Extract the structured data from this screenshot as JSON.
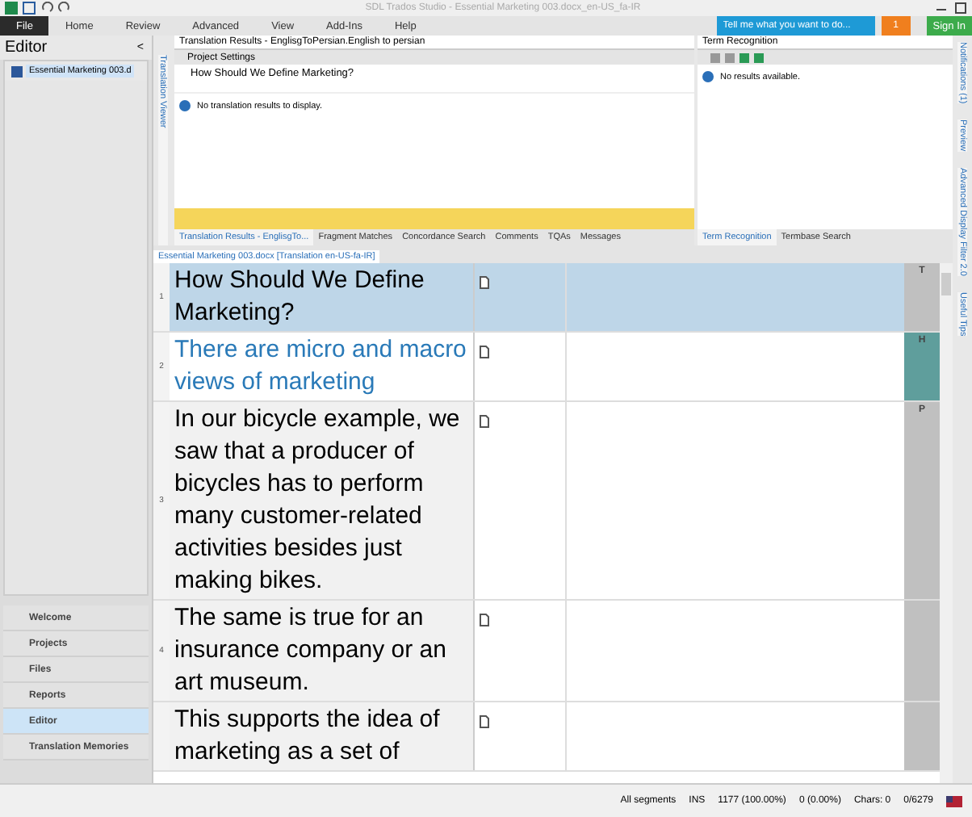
{
  "window": {
    "title": "SDL Trados Studio - Essential Marketing 003.docx_en-US_fa-IR"
  },
  "ribbon_tabs": [
    {
      "label": "File",
      "selected": true
    },
    {
      "label": "Home",
      "selected": false
    },
    {
      "label": "Review",
      "selected": false
    },
    {
      "label": "Advanced",
      "selected": false
    },
    {
      "label": "View",
      "selected": false
    },
    {
      "label": "Add-Ins",
      "selected": false
    },
    {
      "label": "Help",
      "selected": false
    }
  ],
  "tell_me": {
    "placeholder": "Tell me what you want to do..."
  },
  "notification_count": "1",
  "sign_in": "Sign In",
  "sidebar": {
    "title": "Editor",
    "collapse": "<",
    "file": "Essential Marketing 003.d",
    "nav": [
      {
        "label": "Welcome",
        "selected": false
      },
      {
        "label": "Projects",
        "selected": false
      },
      {
        "label": "Files",
        "selected": false
      },
      {
        "label": "Reports",
        "selected": false
      },
      {
        "label": "Editor",
        "selected": true
      },
      {
        "label": "Translation Memories",
        "selected": false
      }
    ]
  },
  "translation_viewer": "Translation Viewer",
  "translation_results": {
    "title": "Translation Results - EnglisgToPersian.English to persian",
    "settings": "Project Settings",
    "source": "How Should We Define Marketing?",
    "message": "No translation results to display.",
    "tabs": [
      {
        "label": "Translation Results - EnglisgTo...",
        "selected": true
      },
      {
        "label": "Fragment Matches",
        "selected": false
      },
      {
        "label": "Concordance Search",
        "selected": false
      },
      {
        "label": "Comments",
        "selected": false
      },
      {
        "label": "TQAs",
        "selected": false
      },
      {
        "label": "Messages",
        "selected": false
      }
    ]
  },
  "term_recognition": {
    "title": "Term Recognition",
    "message": "No results available.",
    "tabs": [
      {
        "label": "Term Recognition",
        "selected": true
      },
      {
        "label": "Termbase Search",
        "selected": false
      }
    ]
  },
  "side_tabs": [
    "Notifications (1)",
    "Preview",
    "Advanced Display Filter 2.0",
    "Useful Tips"
  ],
  "editor": {
    "tab": "Essential Marketing 003.docx [Translation en-US-fa-IR]",
    "rows": [
      {
        "number": "1",
        "source": "How Should We Define Marketing?",
        "selected": true,
        "highlighted": false,
        "status": "T",
        "color": "#c0c0c0"
      },
      {
        "number": "2",
        "source": "There are micro and macro views of marketing",
        "selected": false,
        "highlighted": true,
        "status": "H",
        "color": "#5f9e9c"
      },
      {
        "number": "3",
        "source": "In our bicycle example, we saw that a producer of bicycles has to perform many customer-related activities besides just making bikes.",
        "selected": false,
        "highlighted": false,
        "status": "P",
        "color": "#c0c0c0"
      },
      {
        "number": "4",
        "source": "The same is true for an insurance company or an art museum.",
        "selected": false,
        "highlighted": false,
        "status": "",
        "color": "#c0c0c0"
      },
      {
        "number": "",
        "source": "This supports the idea of marketing as a set of",
        "selected": false,
        "highlighted": false,
        "status": "",
        "color": "#c0c0c0"
      }
    ]
  },
  "status_bar": {
    "filter": "All segments",
    "mode": "INS",
    "confirmed": "1177 (100.00%)",
    "unconfirmed": "0 (0.00%)",
    "chars": "Chars: 0",
    "words": "0/6279"
  }
}
